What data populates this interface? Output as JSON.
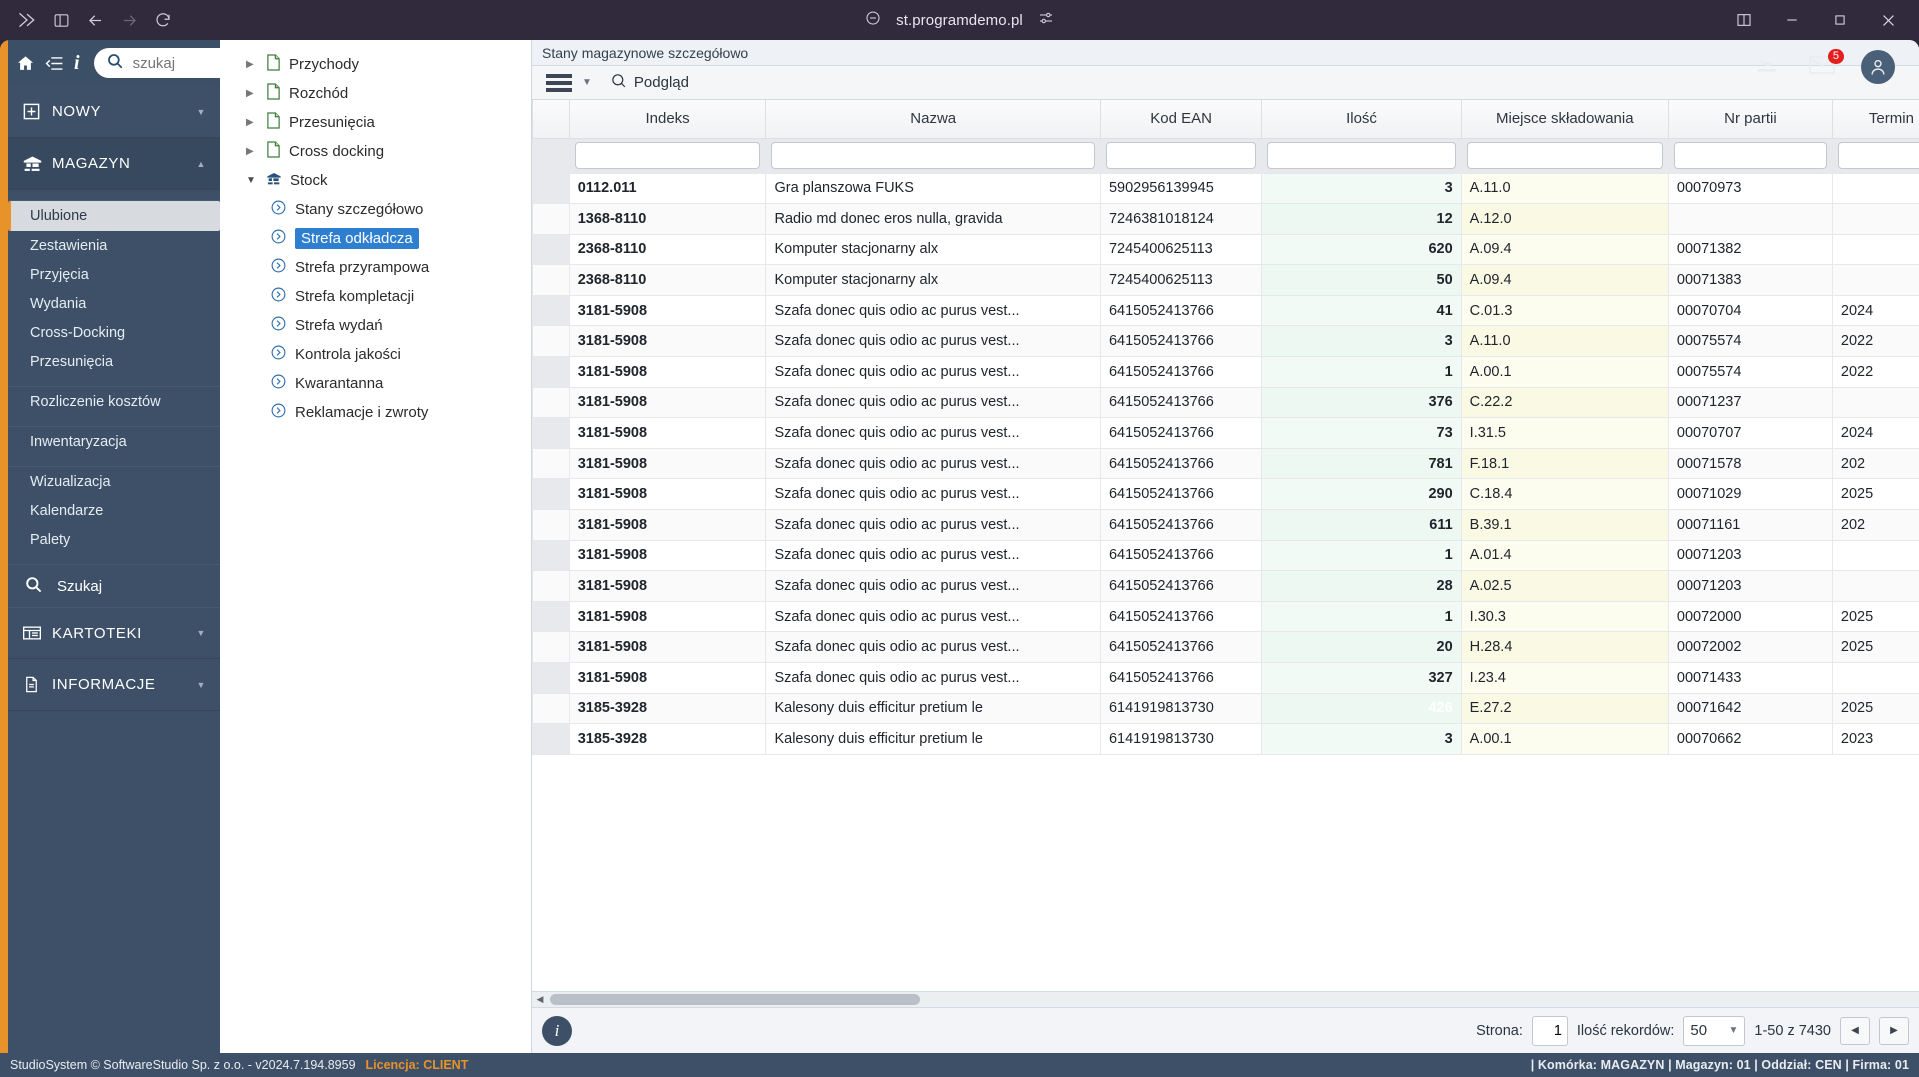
{
  "browser": {
    "url": "st.programdemo.pl",
    "nav": [
      "back-arrow",
      "forward-arrow",
      "reload"
    ],
    "window_controls": [
      "split-view",
      "minimize",
      "maximize",
      "close"
    ]
  },
  "topbar": {
    "search_placeholder": "szukaj",
    "search_value": "",
    "mail_badge": "5",
    "icons": [
      "home-icon",
      "collapse-icon",
      "info-icon",
      "send-icon",
      "mail-icon",
      "user-avatar"
    ]
  },
  "sidebar": {
    "new_label": "NOWY",
    "warehouse_label": "MAGAZYN",
    "items": [
      {
        "label": "Ulubione",
        "selected": true
      },
      {
        "label": "Zestawienia",
        "selected": false
      },
      {
        "label": "Przyjęcia",
        "selected": false
      },
      {
        "label": "Wydania",
        "selected": false
      },
      {
        "label": "Cross-Docking",
        "selected": false
      },
      {
        "label": "Przesunięcia",
        "selected": false
      }
    ],
    "items2": [
      {
        "label": "Rozliczenie kosztów"
      }
    ],
    "items3": [
      {
        "label": "Inwentaryzacja"
      }
    ],
    "items4": [
      {
        "label": "Wizualizacja"
      },
      {
        "label": "Kalendarze"
      },
      {
        "label": "Palety"
      }
    ],
    "search_label": "Szukaj",
    "kartoteki_label": "KARTOTEKI",
    "informacje_label": "INFORMACJE"
  },
  "tree": [
    {
      "label": "Przychody",
      "icon": "doc-icon",
      "expanded": false,
      "level": 0,
      "selected": false
    },
    {
      "label": "Rozchód",
      "icon": "doc-icon",
      "expanded": false,
      "level": 0,
      "selected": false
    },
    {
      "label": "Przesunięcia",
      "icon": "doc-icon",
      "expanded": false,
      "level": 0,
      "selected": false
    },
    {
      "label": "Cross docking",
      "icon": "doc-icon",
      "expanded": false,
      "level": 0,
      "selected": false
    },
    {
      "label": "Stock",
      "icon": "stock-icon",
      "expanded": true,
      "level": 0,
      "selected": false
    },
    {
      "label": "Stany szczegółowo",
      "icon": "arrow-circle-icon",
      "level": 1,
      "selected": false
    },
    {
      "label": "Strefa odkładcza",
      "icon": "arrow-circle-icon",
      "level": 1,
      "selected": true
    },
    {
      "label": "Strefa przyrampowa",
      "icon": "arrow-circle-icon",
      "level": 1,
      "selected": false
    },
    {
      "label": "Strefa kompletacji",
      "icon": "arrow-circle-icon",
      "level": 1,
      "selected": false
    },
    {
      "label": "Strefa wydań",
      "icon": "arrow-circle-icon",
      "level": 1,
      "selected": false
    },
    {
      "label": "Kontrola jakości",
      "icon": "arrow-circle-icon",
      "level": 1,
      "selected": false
    },
    {
      "label": "Kwarantanna",
      "icon": "arrow-circle-icon",
      "level": 1,
      "selected": false
    },
    {
      "label": "Reklamacje i zwroty",
      "icon": "arrow-circle-icon",
      "level": 1,
      "selected": false
    }
  ],
  "content": {
    "tab_title": "Stany magazynowe szczegółowo",
    "toolbar_preview": "Podgląd"
  },
  "table": {
    "columns": [
      "Indeks",
      "Nazwa",
      "Kod EAN",
      "Ilość",
      "Miejsce składowania",
      "Nr partii",
      "Termin"
    ],
    "filters": [
      "",
      "",
      "",
      "",
      "",
      "",
      ""
    ],
    "rows": [
      {
        "indeks": "0112.011",
        "nazwa": "Gra planszowa FUKS",
        "ean": "5902956139945",
        "ilosc": "3",
        "miejsce": "A.11.0",
        "partia": "00070973",
        "termin": "",
        "highlight": false
      },
      {
        "indeks": "1368-8110",
        "nazwa": "Radio md donec eros nulla, gravida",
        "ean": "7246381018124",
        "ilosc": "12",
        "miejsce": "A.12.0",
        "partia": "",
        "termin": "",
        "highlight": false
      },
      {
        "indeks": "2368-8110",
        "nazwa": "Komputer stacjonarny alx",
        "ean": "7245400625113",
        "ilosc": "620",
        "miejsce": "A.09.4",
        "partia": "00071382",
        "termin": "",
        "highlight": false
      },
      {
        "indeks": "2368-8110",
        "nazwa": "Komputer stacjonarny alx",
        "ean": "7245400625113",
        "ilosc": "50",
        "miejsce": "A.09.4",
        "partia": "00071383",
        "termin": "",
        "highlight": false
      },
      {
        "indeks": "3181-5908",
        "nazwa": "Szafa donec quis odio ac purus vest...",
        "ean": "6415052413766",
        "ilosc": "41",
        "miejsce": "C.01.3",
        "partia": "00070704",
        "termin": "2024",
        "highlight": false
      },
      {
        "indeks": "3181-5908",
        "nazwa": "Szafa donec quis odio ac purus vest...",
        "ean": "6415052413766",
        "ilosc": "3",
        "miejsce": "A.11.0",
        "partia": "00075574",
        "termin": "2022",
        "highlight": false
      },
      {
        "indeks": "3181-5908",
        "nazwa": "Szafa donec quis odio ac purus vest...",
        "ean": "6415052413766",
        "ilosc": "1",
        "miejsce": "A.00.1",
        "partia": "00075574",
        "termin": "2022",
        "highlight": false
      },
      {
        "indeks": "3181-5908",
        "nazwa": "Szafa donec quis odio ac purus vest...",
        "ean": "6415052413766",
        "ilosc": "376",
        "miejsce": "C.22.2",
        "partia": "00071237",
        "termin": "",
        "highlight": false
      },
      {
        "indeks": "3181-5908",
        "nazwa": "Szafa donec quis odio ac purus vest...",
        "ean": "6415052413766",
        "ilosc": "73",
        "miejsce": "I.31.5",
        "partia": "00070707",
        "termin": "2024",
        "highlight": false
      },
      {
        "indeks": "3181-5908",
        "nazwa": "Szafa donec quis odio ac purus vest...",
        "ean": "6415052413766",
        "ilosc": "781",
        "miejsce": "F.18.1",
        "partia": "00071578",
        "termin": "202",
        "highlight": false
      },
      {
        "indeks": "3181-5908",
        "nazwa": "Szafa donec quis odio ac purus vest...",
        "ean": "6415052413766",
        "ilosc": "290",
        "miejsce": "C.18.4",
        "partia": "00071029",
        "termin": "2025",
        "highlight": false
      },
      {
        "indeks": "3181-5908",
        "nazwa": "Szafa donec quis odio ac purus vest...",
        "ean": "6415052413766",
        "ilosc": "611",
        "miejsce": "B.39.1",
        "partia": "00071161",
        "termin": "202",
        "highlight": false
      },
      {
        "indeks": "3181-5908",
        "nazwa": "Szafa donec quis odio ac purus vest...",
        "ean": "6415052413766",
        "ilosc": "1",
        "miejsce": "A.01.4",
        "partia": "00071203",
        "termin": "",
        "highlight": false
      },
      {
        "indeks": "3181-5908",
        "nazwa": "Szafa donec quis odio ac purus vest...",
        "ean": "6415052413766",
        "ilosc": "28",
        "miejsce": "A.02.5",
        "partia": "00071203",
        "termin": "",
        "highlight": false
      },
      {
        "indeks": "3181-5908",
        "nazwa": "Szafa donec quis odio ac purus vest...",
        "ean": "6415052413766",
        "ilosc": "1",
        "miejsce": "I.30.3",
        "partia": "00072000",
        "termin": "2025",
        "highlight": false
      },
      {
        "indeks": "3181-5908",
        "nazwa": "Szafa donec quis odio ac purus vest...",
        "ean": "6415052413766",
        "ilosc": "20",
        "miejsce": "H.28.4",
        "partia": "00072002",
        "termin": "2025",
        "highlight": false
      },
      {
        "indeks": "3181-5908",
        "nazwa": "Szafa donec quis odio ac purus vest...",
        "ean": "6415052413766",
        "ilosc": "327",
        "miejsce": "I.23.4",
        "partia": "00071433",
        "termin": "",
        "highlight": false
      },
      {
        "indeks": "3185-3928",
        "nazwa": "Kalesony duis efficitur pretium le",
        "ean": "6141919813730",
        "ilosc": "426",
        "miejsce": "E.27.2",
        "partia": "00071642",
        "termin": "2025",
        "highlight": true
      },
      {
        "indeks": "3185-3928",
        "nazwa": "Kalesony duis efficitur pretium le",
        "ean": "6141919813730",
        "ilosc": "3",
        "miejsce": "A.00.1",
        "partia": "00070662",
        "termin": "2023",
        "highlight": false
      }
    ]
  },
  "pager": {
    "page_label": "Strona:",
    "page_value": "1",
    "rows_label": "Ilość rekordów:",
    "rows_value": "50",
    "range_text": "1-50 z 7430"
  },
  "statusbar": {
    "left": "StudioSystem © SoftwareStudio Sp. z o.o. - v2024.7.194.8959",
    "license": "Licencja: CLIENT",
    "right": "| Komórka: MAGAZYN | Magazyn: 01 | Oddział: CEN | Firma: 01"
  },
  "colors": {
    "accent": "#e8922a",
    "sidebar": "#3d5067",
    "chrome": "#312a3c",
    "selection": "#2f7fd1",
    "qty_highlight": "#2c6fb0"
  }
}
